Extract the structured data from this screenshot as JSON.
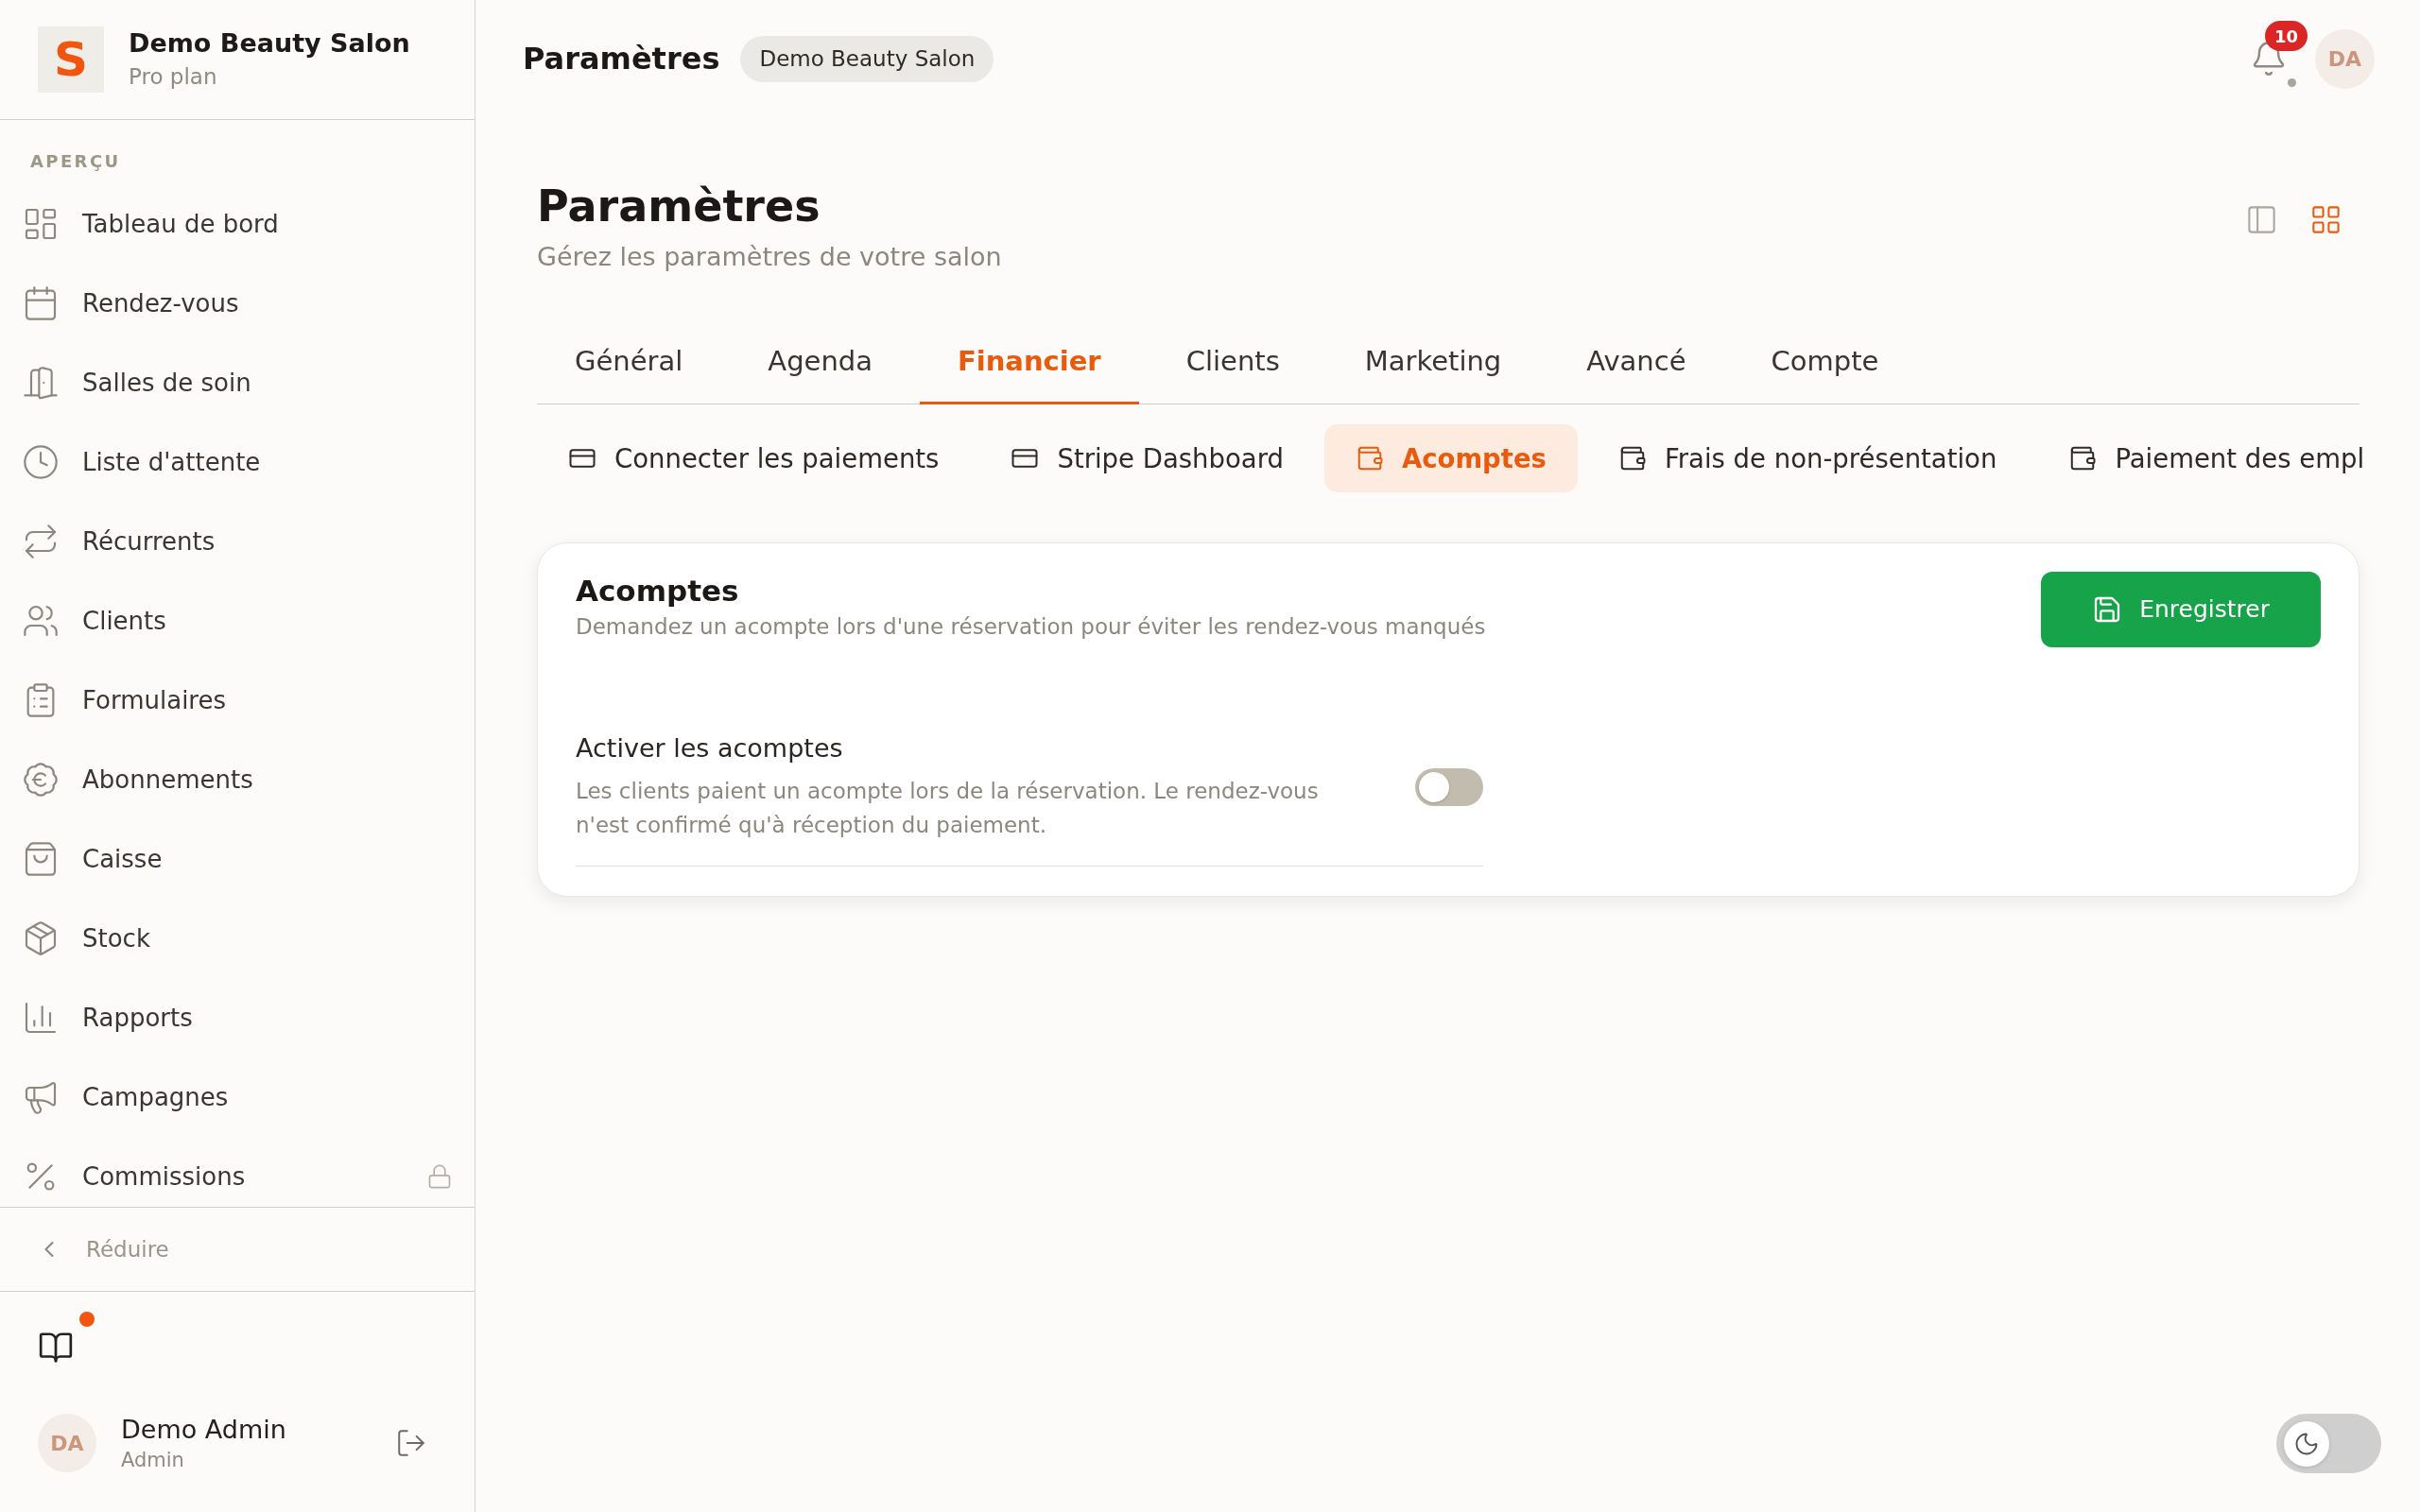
{
  "sidebar": {
    "brand": {
      "logo": "S",
      "name": "Demo Beauty Salon",
      "plan": "Pro plan"
    },
    "section_label": "APERÇU",
    "items": [
      {
        "label": "Tableau de bord",
        "selected": false,
        "locked": false
      },
      {
        "label": "Rendez-vous",
        "selected": false,
        "locked": false
      },
      {
        "label": "Salles de soin",
        "selected": false,
        "locked": false
      },
      {
        "label": "Liste d'attente",
        "selected": false,
        "locked": false
      },
      {
        "label": "Récurrents",
        "selected": false,
        "locked": false
      },
      {
        "label": "Clients",
        "selected": false,
        "locked": false
      },
      {
        "label": "Formulaires",
        "selected": false,
        "locked": false
      },
      {
        "label": "Abonnements",
        "selected": false,
        "locked": false
      },
      {
        "label": "Caisse",
        "selected": false,
        "locked": false
      },
      {
        "label": "Stock",
        "selected": false,
        "locked": false
      },
      {
        "label": "Rapports",
        "selected": false,
        "locked": false
      },
      {
        "label": "Campagnes",
        "selected": false,
        "locked": false
      },
      {
        "label": "Commissions",
        "selected": false,
        "locked": true
      }
    ],
    "collapse": {
      "label": "Réduire"
    },
    "guide": {
      "unread": true
    },
    "user": {
      "initials": "DA",
      "name": "Demo Admin",
      "role": "Admin"
    }
  },
  "header": {
    "title": "Paramètres",
    "salon": "Demo Beauty Salon",
    "notifications": {
      "count": "10"
    },
    "avatar": {
      "initials": "DA"
    }
  },
  "page": {
    "title": "Paramètres",
    "subtitle": "Gérez les paramètres de votre salon",
    "view_modes": [
      {
        "selected": false
      },
      {
        "selected": true
      }
    ]
  },
  "tabs": [
    {
      "label": "Général",
      "selected": false
    },
    {
      "label": "Agenda",
      "selected": false
    },
    {
      "label": "Financier",
      "selected": true
    },
    {
      "label": "Clients",
      "selected": false
    },
    {
      "label": "Marketing",
      "selected": false
    },
    {
      "label": "Avancé",
      "selected": false
    },
    {
      "label": "Compte",
      "selected": false
    }
  ],
  "subtabs": [
    {
      "label": "Connecter les paiements",
      "selected": false
    },
    {
      "label": "Stripe Dashboard",
      "selected": false
    },
    {
      "label": "Acomptes",
      "selected": true
    },
    {
      "label": "Frais de non-présentation",
      "selected": false
    },
    {
      "label": "Paiement des empl",
      "selected": false
    }
  ],
  "card": {
    "title": "Acomptes",
    "description": "Demandez un acompte lors d'une réservation pour éviter les rendez-vous manqués",
    "save_button": "Enregistrer",
    "settings": [
      {
        "label": "Activer les acomptes",
        "description": "Les clients paient un acompte lors de la réservation. Le rendez-vous n'est confirmé qu'à réception du paiement.",
        "on": false
      }
    ]
  },
  "theme_toggle": {
    "on": false
  }
}
